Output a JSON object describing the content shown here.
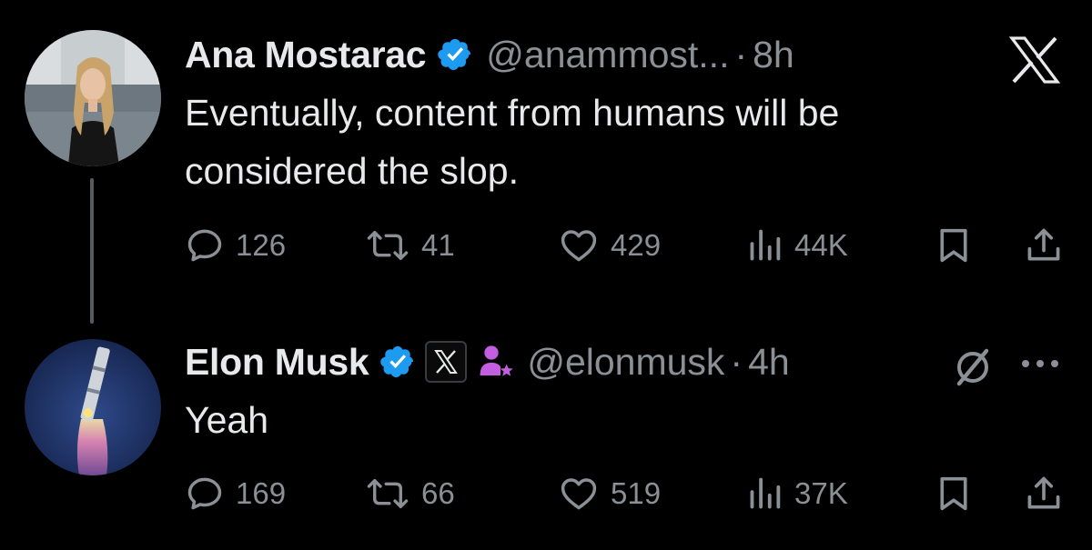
{
  "tweets": [
    {
      "name": "Ana Mostarac",
      "handle": "@anammost...",
      "separator": "·",
      "time": "8h",
      "text_lines": [
        "Eventually, content from humans will be",
        "considered the slop."
      ],
      "stats": {
        "replies": "126",
        "reposts": "41",
        "likes": "429",
        "views": "44K"
      }
    },
    {
      "name": "Elon Musk",
      "handle": "@elonmusk",
      "separator": "·",
      "time": "4h",
      "text_lines": [
        "Yeah"
      ],
      "stats": {
        "replies": "169",
        "reposts": "66",
        "likes": "519",
        "views": "37K"
      }
    }
  ],
  "colors": {
    "background": "#000000",
    "primary_text": "#e7e9ea",
    "secondary_text": "#8b9096",
    "verified_blue": "#1d9bf0",
    "affiliate_purple": "#c45ee0",
    "thread_line": "#555a5e"
  },
  "icons": {
    "reply": "speech-bubble-icon",
    "repost": "repost-arrows-icon",
    "like": "heart-icon",
    "views": "bar-chart-icon",
    "bookmark": "bookmark-icon",
    "share": "share-upload-icon",
    "verified": "verified-badge-icon",
    "x_logo": "x-logo-icon",
    "grok": "grok-slash-circle-icon",
    "more": "ellipsis-icon",
    "affiliate": "person-star-icon"
  }
}
